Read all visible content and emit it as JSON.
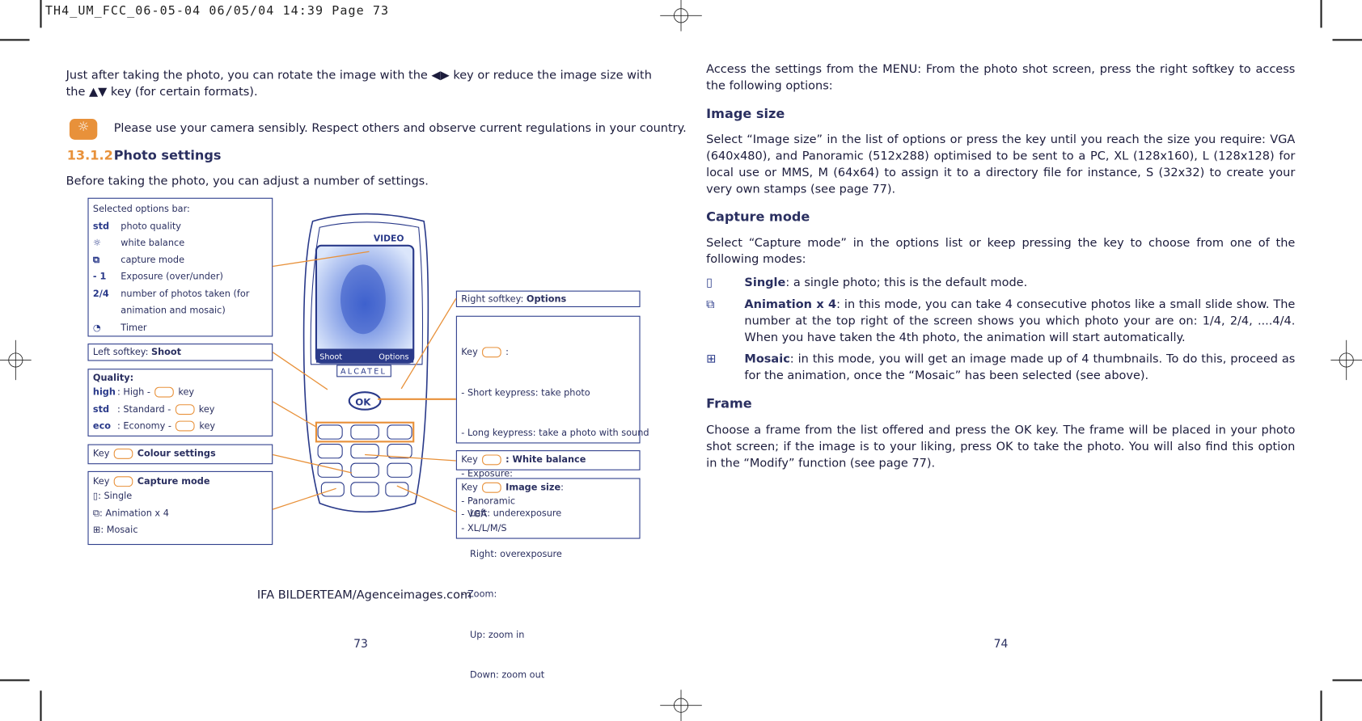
{
  "header": {
    "slug": "TH4_UM_FCC_06-05-04  06/05/04  14:39  Page 73"
  },
  "left": {
    "intro": "Just after taking the photo, you can rotate the image with the ◀▶ key or reduce the image size with the ▲▼ key (for certain formats).",
    "note": "Please use your camera sensibly. Respect others and observe current regulations in your country.",
    "section_num": "13.1.2",
    "section_title": "Photo settings",
    "before": "Before taking the photo, you can adjust a number of settings.",
    "options_bar": {
      "title": "Selected options bar:",
      "items": [
        {
          "icon": "std",
          "label": "photo quality"
        },
        {
          "icon": "☼",
          "label": "white balance"
        },
        {
          "icon": "⧉",
          "label": "capture mode"
        },
        {
          "icon": "- 1",
          "label": "Exposure (over/under)"
        },
        {
          "icon": "2/4",
          "label": "number of photos taken (for"
        },
        {
          "icon": "",
          "label": "animation and mosaic)"
        },
        {
          "icon": "◔",
          "label": "Timer"
        }
      ]
    },
    "left_softkey": {
      "label": "Left softkey: ",
      "value": "Shoot"
    },
    "quality": {
      "title": "Quality:",
      "items": [
        {
          "icon": "high",
          "label": ": High -",
          "suffix": "key"
        },
        {
          "icon": "std",
          "label": ": Standard -",
          "suffix": "key"
        },
        {
          "icon": "eco",
          "label": ": Economy -",
          "suffix": "key"
        }
      ]
    },
    "colour": {
      "key": "Key",
      "label": "Colour settings"
    },
    "capture": {
      "key": "Key",
      "label": "Capture mode",
      "items": [
        ": Single",
        ": Animation x 4",
        ": Mosaic"
      ]
    },
    "right_softkey": {
      "label": "Right softkey: ",
      "value": "Options"
    },
    "ok_key": {
      "key": "Key",
      "lines": [
        "- Short keypress: take photo",
        "- Long keypress: take a photo with sound",
        "- Exposure:",
        "   Left: underexposure",
        "   Right: overexposure",
        "- Zoom:",
        "   Up: zoom in",
        "   Down: zoom out"
      ]
    },
    "white_balance": {
      "key": "Key",
      "label": ": White balance"
    },
    "image_size": {
      "key": "Key",
      "label": "Image size",
      "items": [
        "- Panoramic",
        "- VGA",
        "- XL/L/M/S"
      ]
    },
    "phone": {
      "brand": "ALCATEL",
      "video": "VIDEO",
      "soft_left": "Shoot",
      "soft_right": "Options"
    },
    "credit": "IFA BILDERTEAM/Agenceimages.com",
    "page": "73"
  },
  "right": {
    "intro": "Access the settings from the MENU: From the photo shot screen, press the right softkey to access the following options:",
    "image_size_h": "Image size",
    "image_size_p": "Select “Image size” in the list of options or press the key until you reach the size you require: VGA (640x480), and Panoramic (512x288) optimised to be sent to a PC, XL (128x160), L (128x128) for local use or MMS, M (64x64) to assign it to a directory file for instance, S (32x32) to create your very own stamps (see page 77).",
    "capture_h": "Capture mode",
    "capture_p": "Select “Capture mode” in the options list or keep pressing the key to choose from one of the following modes:",
    "modes": [
      {
        "name": "Single",
        "text": ": a single photo; this is the default mode."
      },
      {
        "name": "Animation x 4",
        "text": ": in this mode, you can take 4 consecutive photos like a small slide show. The number at the top right of the screen shows you which photo your are on: 1/4, 2/4, ....4/4. When you have taken the 4th photo, the animation will start automatically."
      },
      {
        "name": "Mosaic",
        "text": ": in this mode, you will get an image made up of 4 thumbnails. To do this, proceed as for the animation, once the “Mosaic” has been selected (see above)."
      }
    ],
    "frame_h": "Frame",
    "frame_p": "Choose a frame from the list offered and press the OK key. The frame will be placed in your photo shot screen; if the image is to your liking, press OK to take the photo. You will also find this option in the “Modify” function (see page 77).",
    "page": "74"
  },
  "colors": {
    "accent": "#2a3a8a",
    "line": "#e8913a"
  }
}
